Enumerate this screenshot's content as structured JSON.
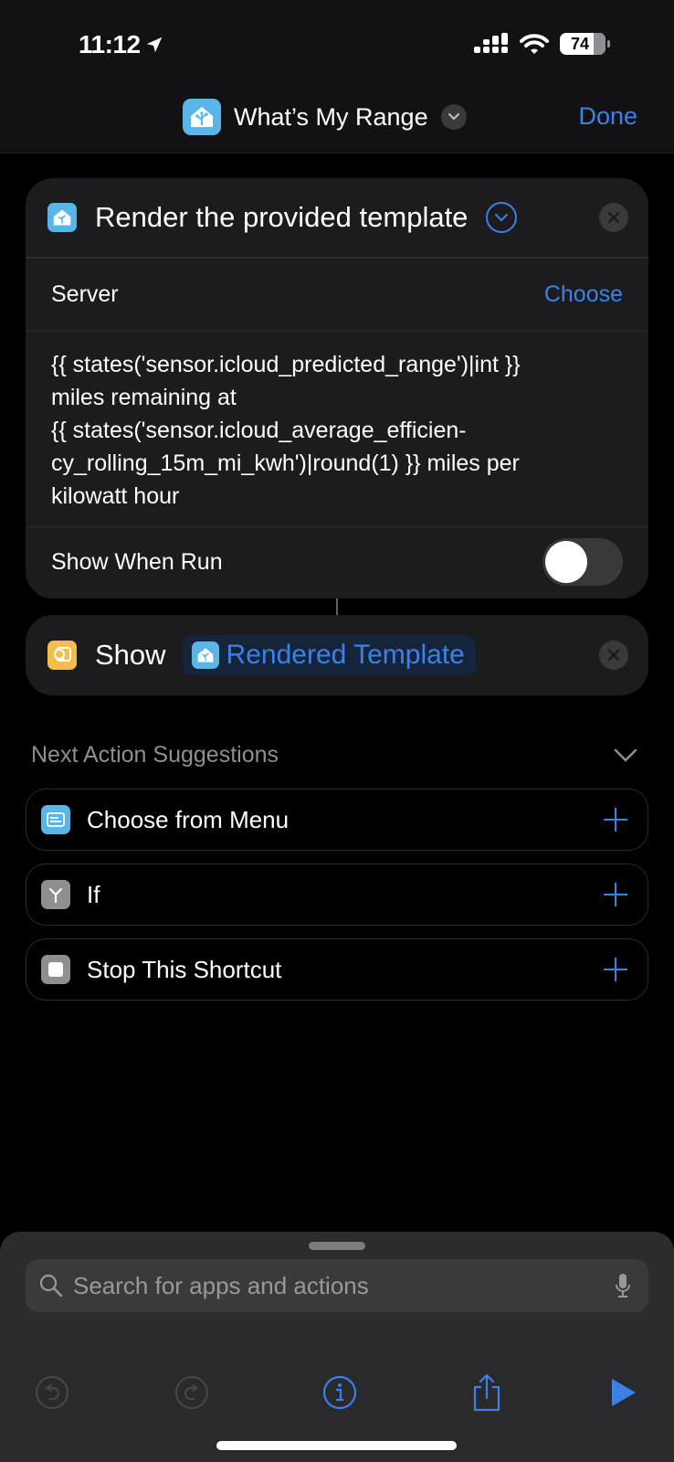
{
  "status_bar": {
    "time": "11:12",
    "battery": "74",
    "icons": [
      "location-arrow-icon",
      "cellular-signal-icon",
      "wifi-icon",
      "battery-icon"
    ]
  },
  "nav": {
    "app_icon": "home-assistant-icon",
    "title": "What’s My Range",
    "done_label": "Done"
  },
  "action_render": {
    "icon": "home-assistant-icon",
    "title": "Render the provided template",
    "server_label": "Server",
    "server_value": "Choose",
    "template": "{{ states('sensor.icloud_predicted_range')|int }} miles remaining at {{ states('sensor.icloud_average_efficien-cy_rolling_15m_mi_kwh')|round(1) }} miles per kilowatt hour",
    "template_lines": [
      "{{ states('sensor.icloud_predicted_range')|int }}",
      "miles remaining at",
      "{{ states('sensor.icloud_average_efficien-",
      "cy_rolling_15m_mi_kwh')|round(1) }} miles per",
      "kilowatt hour"
    ],
    "show_when_run_label": "Show When Run",
    "show_when_run": false
  },
  "action_show": {
    "icon": "show-result-icon",
    "label": "Show",
    "variable_icon": "home-assistant-icon",
    "variable": "Rendered Template"
  },
  "suggestions": {
    "title": "Next Action Suggestions",
    "items": [
      {
        "label": "Choose from Menu",
        "icon": "menu-icon",
        "color": "#5ab5e8"
      },
      {
        "label": "If",
        "icon": "branch-icon",
        "color": "#8e8e93"
      },
      {
        "label": "Stop This Shortcut",
        "icon": "stop-icon",
        "color": "#8e8e93"
      }
    ]
  },
  "search": {
    "placeholder": "Search for apps and actions",
    "value": ""
  },
  "toolbar": {
    "buttons": [
      "undo",
      "redo",
      "info",
      "share",
      "run"
    ]
  },
  "colors": {
    "accent": "#3b82e6",
    "card": "#1c1c1e",
    "home_assistant": "#5ab5e8",
    "show_action": "#f2c04a"
  }
}
